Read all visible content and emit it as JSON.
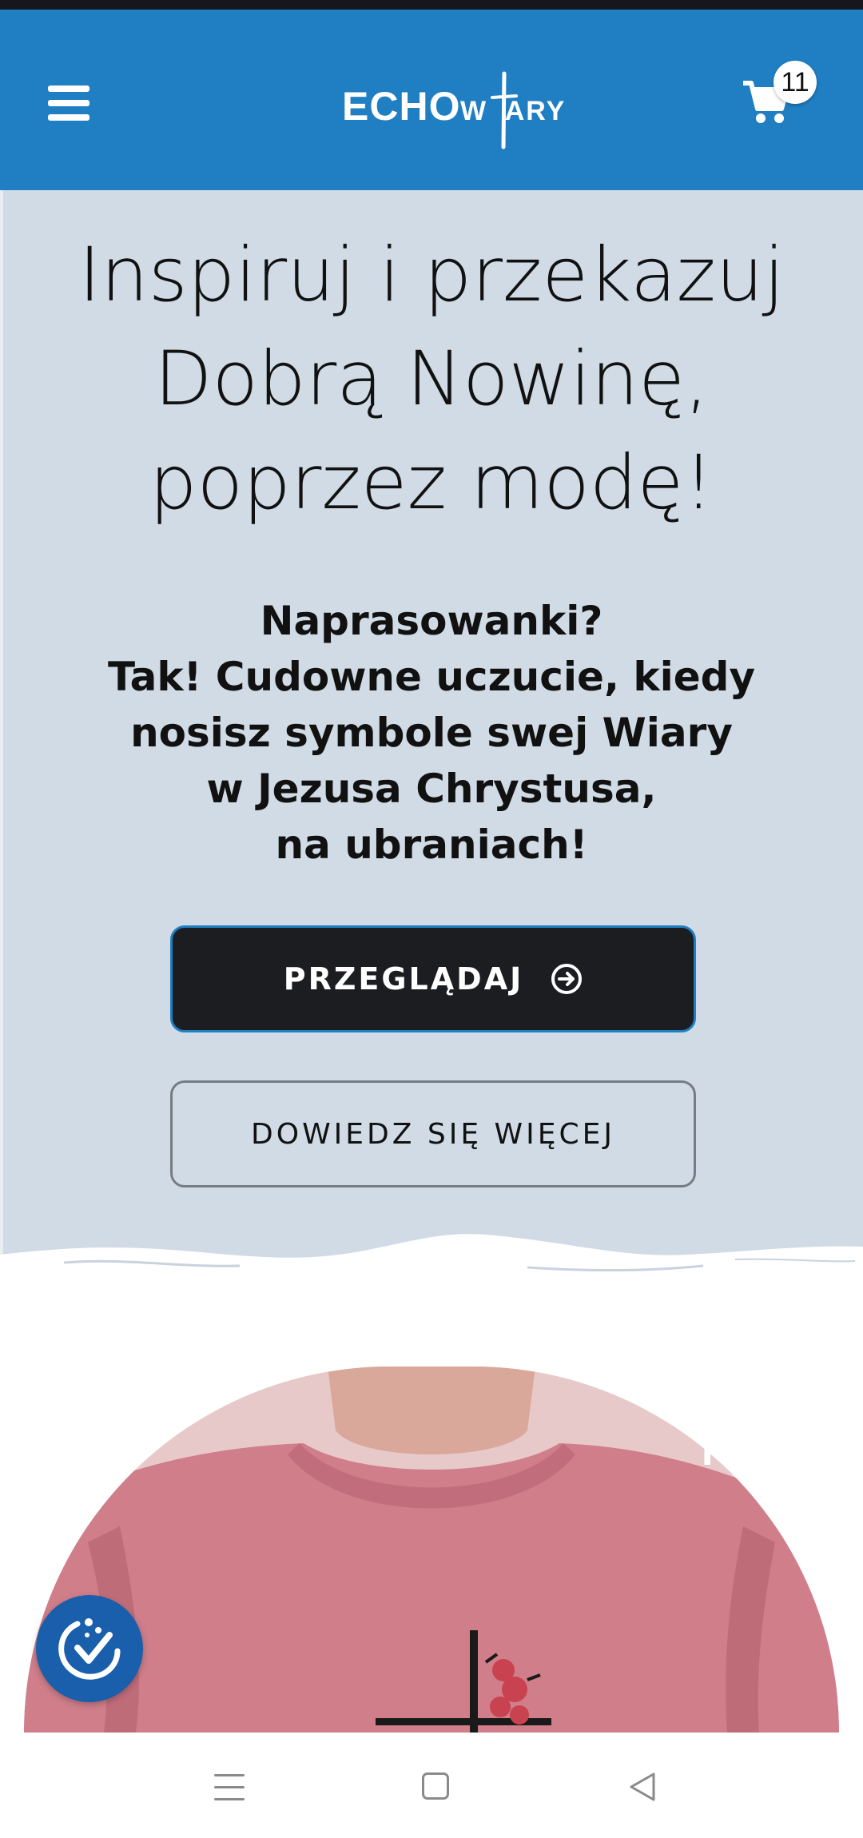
{
  "header": {
    "logo_echo": "ECHO",
    "logo_wiary": "W  ARY",
    "cart_count": "11",
    "brand_color": "#1f7fc2"
  },
  "hero": {
    "title_lines": [
      "Inspiruj i przekazuj",
      "Dobrą Nowinę,",
      "poprzez modę!"
    ],
    "subtitle_lines": [
      "Naprasowanki?",
      "Tak! Cudowne uczucie, kiedy",
      "nosisz symbole swej Wiary",
      "w Jezusa Chrystusa,",
      "na ubraniach!"
    ],
    "primary_button": "PRZEGLĄDAJ",
    "secondary_button": "DOWIEDZ SIĘ WIĘCEJ",
    "background_color": "#d0dbe5"
  },
  "product": {
    "overlay_text": "P"
  },
  "icons": {
    "menu": "hamburger-icon",
    "cart": "cart-icon",
    "arrow": "arrow-right-circle-icon",
    "accessibility": "accessibility-icon"
  }
}
